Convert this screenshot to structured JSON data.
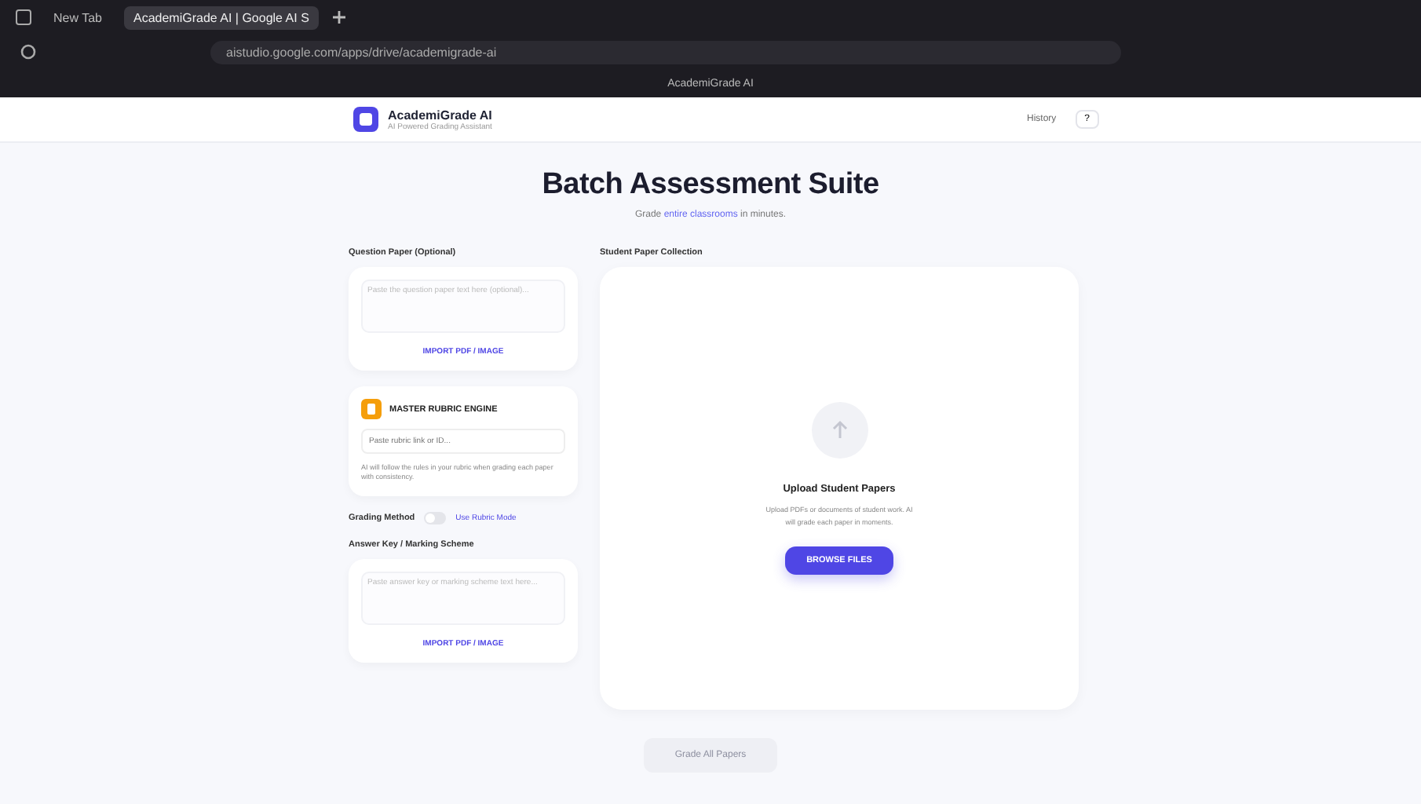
{
  "browser": {
    "tabs": [
      {
        "label": "New Tab",
        "selected": false
      },
      {
        "label": "AcademiGrade AI | Google AI S",
        "selected": true
      }
    ],
    "address": "aistudio.google.com/apps/drive/academigrade-ai",
    "page_title": "AcademiGrade AI"
  },
  "header": {
    "app_name": "AcademiGrade AI",
    "tagline": "AI Powered Grading Assistant",
    "history_button": "History",
    "help_button": "?"
  },
  "hero": {
    "title": "Batch Assessment Suite",
    "subtitle_before": "Grade ",
    "subtitle_link": "entire classrooms",
    "subtitle_after": " in minutes."
  },
  "question_paper": {
    "label": "Question Paper (Optional)",
    "placeholder": "Paste the question paper text here (optional)...",
    "import_button": "IMPORT PDF / IMAGE"
  },
  "rubric": {
    "title": "MASTER RUBRIC ENGINE",
    "placeholder": "Paste rubric link or ID...",
    "note": "AI will follow the rules in your rubric when grading each paper with consistency."
  },
  "grading": {
    "label": "Grading Method",
    "toggle_on": false,
    "link": "Use Rubric Mode"
  },
  "answer_key": {
    "label": "Answer Key / Marking Scheme",
    "placeholder": "Paste answer key or marking scheme text here...",
    "import_button": "IMPORT PDF / IMAGE"
  },
  "collection": {
    "label": "Student Paper Collection",
    "upload_title": "Upload Student Papers",
    "upload_text": "Upload PDFs or documents of student work. AI will grade each paper in moments.",
    "browse_button": "BROWSE FILES"
  },
  "submit": {
    "label": "Grade All Papers",
    "disabled": true
  }
}
